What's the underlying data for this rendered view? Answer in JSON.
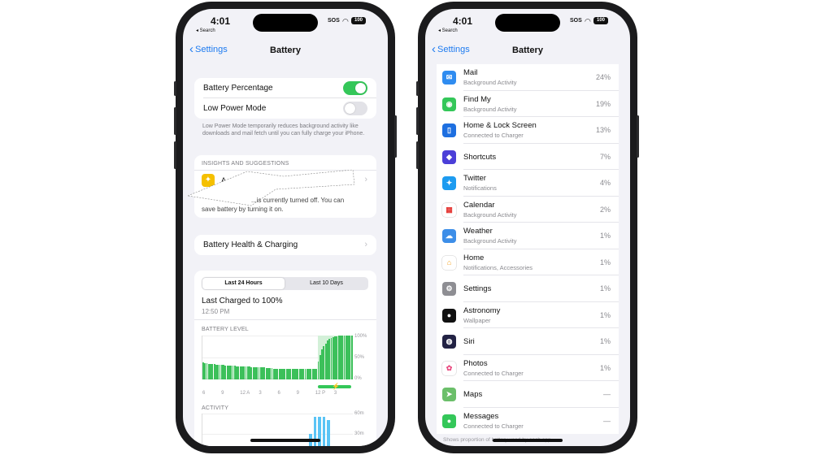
{
  "status": {
    "time": "4:01",
    "back_app": "◂ Search",
    "sos": "SOS",
    "battery": "100"
  },
  "nav": {
    "back_label": "Settings",
    "title": "Battery"
  },
  "left": {
    "toggles": [
      {
        "label": "Battery Percentage",
        "on": true
      },
      {
        "label": "Low Power Mode",
        "on": false
      }
    ],
    "low_power_note": "Low Power Mode temporarily reduces background activity like downloads and mail fetch until you can fully charge your iPhone.",
    "insights_header": "INSIGHTS AND SUGGESTIONS",
    "insight_title": "A... Lo...",
    "insight_body_1": "...is currently turned off. You can",
    "insight_body_2": "save battery by turning it on.",
    "health_label": "Battery Health & Charging",
    "segments": [
      "Last 24 Hours",
      "Last 10 Days"
    ],
    "last_charged": "Last Charged to 100%",
    "last_charged_time": "12:50 PM",
    "battery_level_header": "BATTERY LEVEL",
    "activity_header": "ACTIVITY"
  },
  "chart_data": [
    {
      "type": "bar",
      "title": "BATTERY LEVEL",
      "categories": [
        "6",
        "",
        "9",
        "",
        "12 A",
        "",
        "3",
        "",
        "6",
        "",
        "9",
        "",
        "12 P",
        "",
        "3",
        ""
      ],
      "y_ticks": [
        "100%",
        "50%",
        "0%"
      ],
      "ylim": [
        0,
        100
      ],
      "values": [
        38,
        37,
        37,
        36,
        36,
        35,
        35,
        34,
        34,
        33,
        33,
        33,
        32,
        32,
        32,
        31,
        31,
        31,
        30,
        30,
        30,
        30,
        29,
        29,
        29,
        29,
        28,
        28,
        28,
        28,
        27,
        27,
        27,
        27,
        26,
        26,
        26,
        26,
        25,
        25,
        25,
        25,
        25,
        24,
        24,
        24,
        24,
        24,
        24,
        24,
        24,
        24,
        24,
        24,
        24,
        24,
        24,
        24,
        24,
        24,
        24,
        24,
        40,
        55,
        68,
        76,
        82,
        88,
        92,
        95,
        97,
        98,
        99,
        100,
        100,
        100,
        100,
        100,
        100,
        100,
        100
      ],
      "charging_range": [
        62,
        80
      ]
    },
    {
      "type": "bar",
      "title": "ACTIVITY",
      "y_ticks": [
        "60m",
        "30m"
      ],
      "ylim": [
        0,
        60
      ],
      "values": [
        6,
        5,
        4,
        5,
        4,
        3,
        3,
        4,
        3,
        2,
        3,
        2,
        3,
        2,
        2,
        3,
        2,
        3,
        2,
        2,
        2,
        2,
        3,
        2,
        30,
        55,
        55,
        55,
        50,
        8,
        6,
        10,
        8,
        5
      ]
    }
  ],
  "right": {
    "apps": [
      {
        "name": "Mail",
        "detail": "Background Activity",
        "pct": "24%",
        "icon": "mail-icon",
        "color": "#2f8cf0"
      },
      {
        "name": "Find My",
        "detail": "Background Activity",
        "pct": "19%",
        "icon": "find-my-icon",
        "color": "#34c759"
      },
      {
        "name": "Home & Lock Screen",
        "detail": "Connected to Charger",
        "pct": "13%",
        "icon": "home-lock-icon",
        "color": "#1e6fe0"
      },
      {
        "name": "Shortcuts",
        "detail": "",
        "pct": "7%",
        "icon": "shortcuts-icon",
        "color": "#4b3fd8"
      },
      {
        "name": "Twitter",
        "detail": "Notifications",
        "pct": "4%",
        "icon": "twitter-icon",
        "color": "#1d9bf0"
      },
      {
        "name": "Calendar",
        "detail": "Background Activity",
        "pct": "2%",
        "icon": "calendar-icon",
        "color": "#ffffff"
      },
      {
        "name": "Weather",
        "detail": "Background Activity",
        "pct": "1%",
        "icon": "weather-icon",
        "color": "#3d8ee8"
      },
      {
        "name": "Home",
        "detail": "Notifications, Accessories",
        "pct": "1%",
        "icon": "home-icon",
        "color": "#ffffff"
      },
      {
        "name": "Settings",
        "detail": "",
        "pct": "1%",
        "icon": "gear-icon",
        "color": "#8e8e93"
      },
      {
        "name": "Astronomy",
        "detail": "Wallpaper",
        "pct": "1%",
        "icon": "astronomy-icon",
        "color": "#111111"
      },
      {
        "name": "Siri",
        "detail": "",
        "pct": "1%",
        "icon": "siri-icon",
        "color": "#222244"
      },
      {
        "name": "Photos",
        "detail": "Connected to Charger",
        "pct": "1%",
        "icon": "photos-icon",
        "color": "#ffffff"
      },
      {
        "name": "Maps",
        "detail": "",
        "pct": "—",
        "icon": "maps-icon",
        "color": "#6bbf6a"
      },
      {
        "name": "Messages",
        "detail": "Connected to Charger",
        "pct": "—",
        "icon": "messages-icon",
        "color": "#34c759"
      }
    ],
    "footer": "Shows proportion of battery used by each app."
  },
  "colors": {
    "accent": "#1e7bf0",
    "toggle_on": "#34c759",
    "battery_bar": "#3cc05a",
    "charging_bar": "#bfe8c6",
    "activity_bar": "#5ac4f5"
  }
}
